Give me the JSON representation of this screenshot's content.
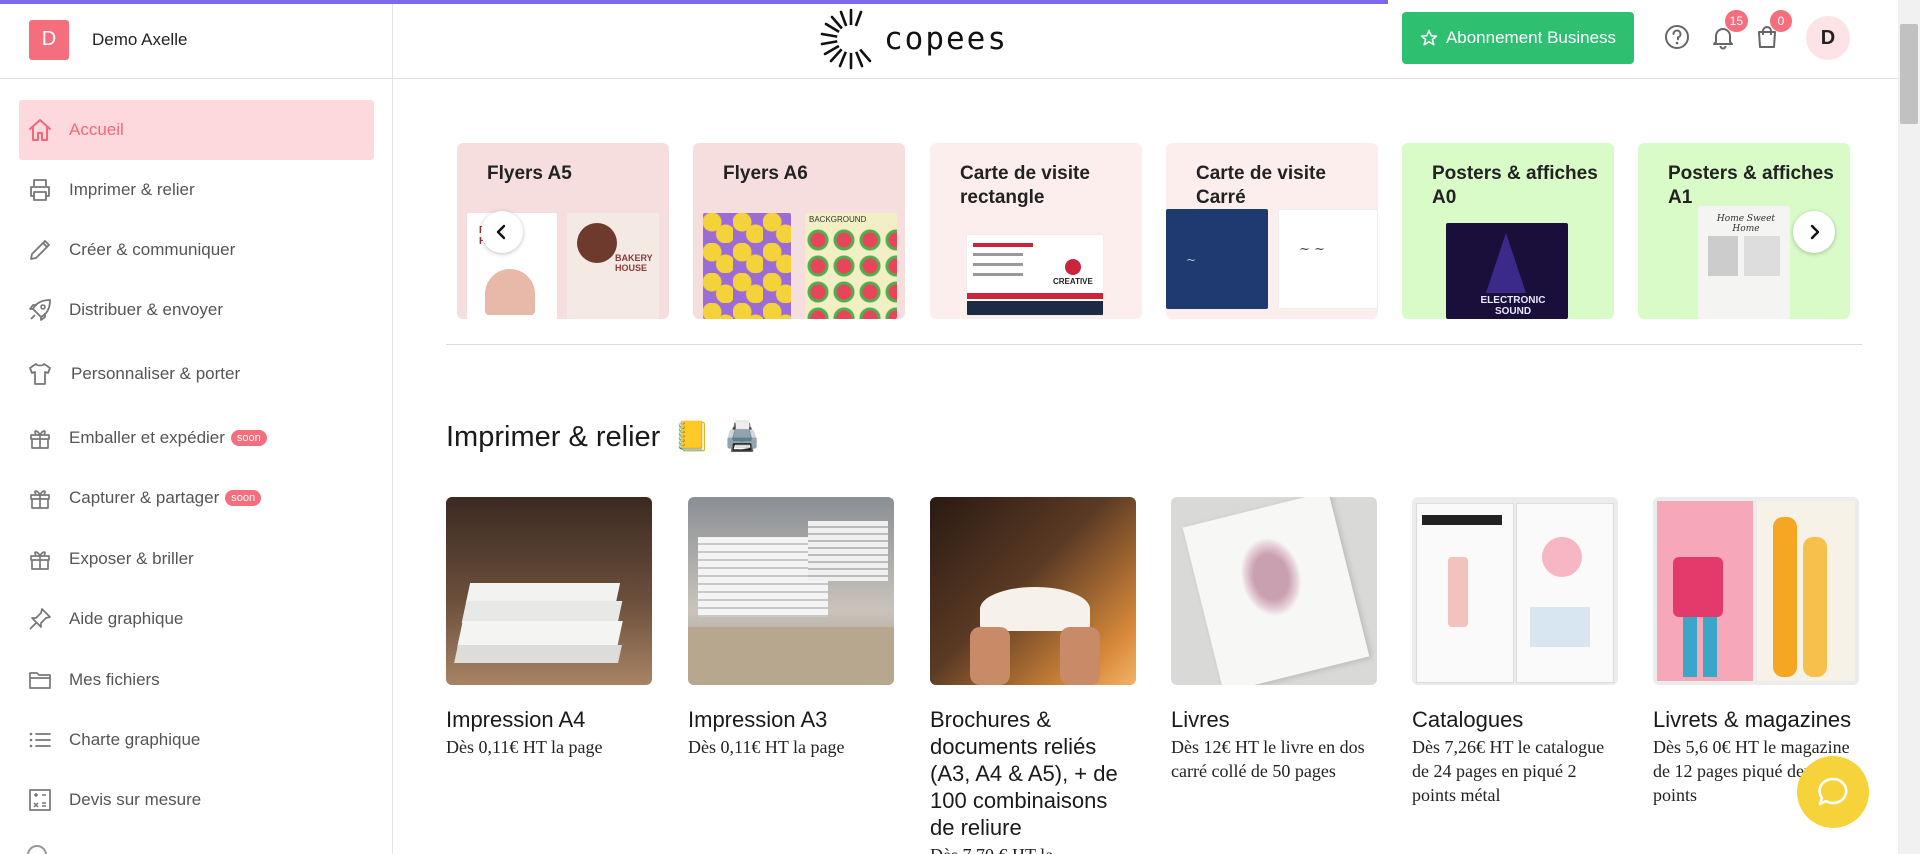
{
  "header": {
    "user_initial": "D",
    "user_name": "Demo Axelle",
    "logo_text": "copees",
    "business_button": "Abonnement Business",
    "notifications_count": "15",
    "cart_count": "0",
    "avatar_initial": "D"
  },
  "sidebar": {
    "items": [
      {
        "label": "Accueil",
        "icon": "home-icon"
      },
      {
        "label": "Imprimer & relier",
        "icon": "printer-icon"
      },
      {
        "label": "Créer & communiquer",
        "icon": "pencil-icon"
      },
      {
        "label": "Distribuer & envoyer",
        "icon": "rocket-icon"
      },
      {
        "label": "Personnaliser & porter",
        "icon": "tshirt-icon"
      },
      {
        "label": "Emballer et expédier",
        "icon": "gift-icon",
        "badge": "soon"
      },
      {
        "label": "Capturer & partager",
        "icon": "gift-icon",
        "badge": "soon"
      },
      {
        "label": "Exposer & briller",
        "icon": "gift-icon"
      },
      {
        "label": "Aide graphique",
        "icon": "pin-icon"
      },
      {
        "label": "Mes fichiers",
        "icon": "folder-icon"
      },
      {
        "label": "Charte graphique",
        "icon": "list-icon"
      },
      {
        "label": "Devis sur mesure",
        "icon": "calculator-icon"
      }
    ]
  },
  "carousel": {
    "cards": [
      {
        "title": "Flyers A5",
        "bg": "#f6dede"
      },
      {
        "title": "Flyers A6",
        "bg": "#f6dede"
      },
      {
        "title": "Carte de visite rectangle",
        "bg": "#fdeeee"
      },
      {
        "title": "Carte de visite Carré",
        "bg": "#fdeeee"
      },
      {
        "title": "Posters & affiches A0",
        "bg": "#d8fbc8"
      },
      {
        "title": "Posters & affiches A1",
        "bg": "#d8fbc8"
      }
    ],
    "thumb_texts": {
      "bakery": "BAKERY HOUSE",
      "background": "BACKGROUND",
      "creative": "CREATIVE",
      "electronic": "ELECTRONIC SOUND",
      "home": "Home Sweet Home"
    }
  },
  "section": {
    "title": "Imprimer & relier",
    "emoji_1": "📒",
    "emoji_2": "🖨️"
  },
  "products": [
    {
      "name": "Impression A4",
      "price": "Dès 0,11€ HT la page"
    },
    {
      "name": "Impression A3",
      "price": "Dès 0,11€ HT la page"
    },
    {
      "name": "Brochures & documents reliés (A3, A4 & A5), + de 100 combinaisons de reliure",
      "price": "Dès 7,70 € HT la"
    },
    {
      "name": "Livres",
      "price": "Dès 12€ HT le livre en dos carré collé de 50 pages"
    },
    {
      "name": "Catalogues",
      "price": "Dès 7,26€ HT le catalogue de 24 pages en piqué 2 points métal"
    },
    {
      "name": "Livrets & magazines",
      "price": "Dès 5,6 0€ HT le magazine de 12 pages piqué deux points"
    }
  ],
  "colors": {
    "accent_pink": "#f46e7e",
    "business_green": "#2fbf71",
    "chat_yellow": "#f7d33b",
    "progress_purple": "#7b68ee"
  }
}
